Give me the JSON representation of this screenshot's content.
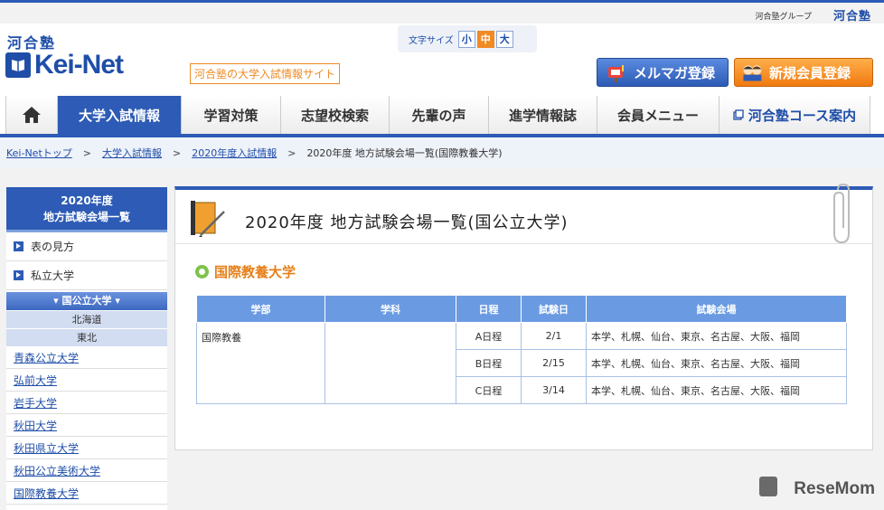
{
  "topbar": {
    "group_text": "河合塾グループ",
    "group_logo": "河合塾"
  },
  "header": {
    "logo_kanji": "河合塾",
    "logo_text": "Kei-Net",
    "tagline": "河合塾の大学入試情報サイト",
    "font_size_label": "文字サイズ",
    "font_size_options": [
      "小",
      "中",
      "大"
    ],
    "mail_button": "メルマガ登録",
    "new_member_button": "新規会員登録"
  },
  "nav": {
    "items": [
      "大学入試情報",
      "学習対策",
      "志望校検索",
      "先輩の声",
      "進学情報誌",
      "会員メニュー",
      "河合塾コース案内"
    ]
  },
  "breadcrumb": {
    "items": [
      "Kei-Netトップ",
      "大学入試情報",
      "2020年度入試情報"
    ],
    "current": "2020年度 地方試験会場一覧(国際教養大学)"
  },
  "sidebar": {
    "title_line1": "2020年度",
    "title_line2": "地方試験会場一覧",
    "links": [
      "表の見方",
      "私立大学"
    ],
    "category": "▾ 国公立大学 ▾",
    "regions": [
      "北海道",
      "東北"
    ],
    "universities": [
      "青森公立大学",
      "弘前大学",
      "岩手大学",
      "秋田大学",
      "秋田県立大学",
      "秋田公立美術大学",
      "国際教養大学"
    ]
  },
  "main": {
    "title": "2020年度 地方試験会場一覧(国公立大学)",
    "university": "国際教養大学",
    "table": {
      "headers": [
        "学部",
        "学科",
        "日程",
        "試験日",
        "試験会場"
      ],
      "faculty": "国際教養",
      "department": "",
      "rows": [
        {
          "schedule": "A日程",
          "date": "2/1",
          "venue": "本学、札幌、仙台、東京、名古屋、大阪、福岡"
        },
        {
          "schedule": "B日程",
          "date": "2/15",
          "venue": "本学、札幌、仙台、東京、名古屋、大阪、福岡"
        },
        {
          "schedule": "C日程",
          "date": "3/14",
          "venue": "本学、札幌、仙台、東京、名古屋、大阪、福岡"
        }
      ]
    }
  },
  "watermark": "ReseMom"
}
